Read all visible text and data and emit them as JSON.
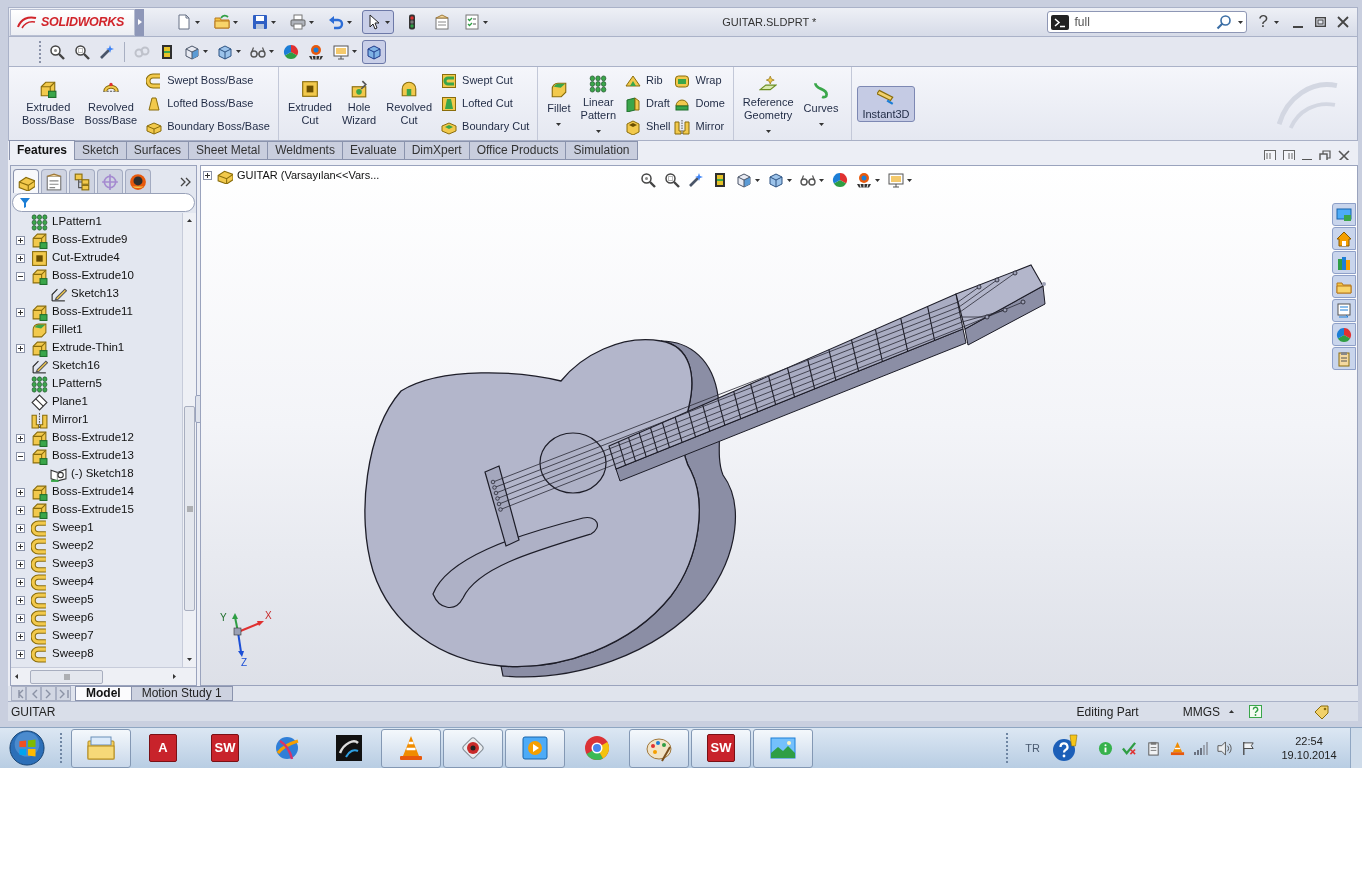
{
  "app": {
    "logo": "SOLIDWORKS",
    "title": "GUITAR.SLDPRT *"
  },
  "quick_access": [
    {
      "kind": "new",
      "dropdown": true,
      "pressed": false
    },
    {
      "kind": "open",
      "dropdown": true,
      "pressed": false
    },
    {
      "kind": "save",
      "dropdown": true,
      "pressed": false
    },
    {
      "kind": "print",
      "dropdown": true,
      "pressed": false
    },
    {
      "kind": "undo",
      "dropdown": true,
      "pressed": false
    },
    {
      "kind": "select",
      "dropdown": true,
      "pressed": true
    },
    {
      "kind": "rebuild",
      "dropdown": false,
      "pressed": false
    },
    {
      "kind": "properties",
      "dropdown": false,
      "pressed": false
    },
    {
      "kind": "options",
      "dropdown": true,
      "pressed": false
    }
  ],
  "search": {
    "value": "full"
  },
  "help": "?",
  "view_toolbar": [
    {
      "kind": "zoom-fit",
      "dropdown": false,
      "pressed": false,
      "disabled": false
    },
    {
      "kind": "zoom-area",
      "dropdown": false,
      "pressed": false,
      "disabled": false
    },
    {
      "kind": "previous",
      "dropdown": false,
      "pressed": false,
      "disabled": false
    },
    {
      "kind": "rings",
      "dropdown": false,
      "pressed": false,
      "disabled": true
    },
    {
      "kind": "section",
      "dropdown": false,
      "pressed": false,
      "disabled": false
    },
    {
      "kind": "orient",
      "dropdown": true,
      "pressed": false,
      "disabled": false
    },
    {
      "kind": "display",
      "dropdown": true,
      "pressed": false,
      "disabled": false
    },
    {
      "kind": "hide",
      "dropdown": true,
      "pressed": false,
      "disabled": false
    },
    {
      "kind": "appearance",
      "dropdown": false,
      "pressed": false,
      "disabled": false
    },
    {
      "kind": "scene",
      "dropdown": false,
      "pressed": false,
      "disabled": false
    },
    {
      "kind": "settings",
      "dropdown": true,
      "pressed": false,
      "disabled": false
    },
    {
      "kind": "shaded",
      "dropdown": false,
      "pressed": true,
      "disabled": false
    }
  ],
  "ribbon": {
    "groups": [
      {
        "large": [
          {
            "kind": "extrude",
            "label": "Extruded\nBoss/Base",
            "dropdown": false
          },
          {
            "kind": "revolve",
            "label": "Revolved\nBoss/Base",
            "dropdown": false
          }
        ],
        "stacks": [
          [
            {
              "kind": "sweep",
              "label": "Swept Boss/Base"
            },
            {
              "kind": "loft",
              "label": "Lofted Boss/Base"
            },
            {
              "kind": "boundary",
              "label": "Boundary Boss/Base"
            }
          ]
        ]
      },
      {
        "large": [
          {
            "kind": "cut-extrude",
            "label": "Extruded\nCut",
            "dropdown": false
          },
          {
            "kind": "hole",
            "label": "Hole\nWizard",
            "dropdown": false
          },
          {
            "kind": "cut-revolve",
            "label": "Revolved\nCut",
            "dropdown": false
          }
        ],
        "stacks": [
          [
            {
              "kind": "cut-sweep",
              "label": "Swept Cut"
            },
            {
              "kind": "cut-loft",
              "label": "Lofted Cut"
            },
            {
              "kind": "cut-boundary",
              "label": "Boundary Cut"
            }
          ]
        ]
      },
      {
        "large": [
          {
            "kind": "fillet",
            "label": "Fillet",
            "dropdown": true
          },
          {
            "kind": "pattern",
            "label": "Linear\nPattern",
            "dropdown": true
          }
        ],
        "stacks": [
          [
            {
              "kind": "rib",
              "label": "Rib"
            },
            {
              "kind": "draft",
              "label": "Draft"
            },
            {
              "kind": "shell",
              "label": "Shell"
            }
          ],
          [
            {
              "kind": "wrap",
              "label": "Wrap"
            },
            {
              "kind": "dome",
              "label": "Dome"
            },
            {
              "kind": "mirror",
              "label": "Mirror"
            }
          ]
        ]
      },
      {
        "large": [
          {
            "kind": "refgeom",
            "label": "Reference\nGeometry",
            "dropdown": true
          },
          {
            "kind": "curves",
            "label": "Curves",
            "dropdown": true
          }
        ]
      }
    ],
    "toggle": {
      "kind": "instant3d",
      "label": "Instant3D",
      "on": true
    }
  },
  "tabs": [
    {
      "label": "Features",
      "selected": true
    },
    {
      "label": "Sketch",
      "selected": false
    },
    {
      "label": "Surfaces",
      "selected": false
    },
    {
      "label": "Sheet Metal",
      "selected": false
    },
    {
      "label": "Weldments",
      "selected": false
    },
    {
      "label": "Evaluate",
      "selected": false
    },
    {
      "label": "DimXpert",
      "selected": false
    },
    {
      "label": "Office Products",
      "selected": false
    },
    {
      "label": "Simulation",
      "selected": false
    }
  ],
  "panel_tabs": [
    {
      "kind": "features",
      "selected": true
    },
    {
      "kind": "properties",
      "selected": false
    },
    {
      "kind": "configurations",
      "selected": false
    },
    {
      "kind": "dimxpert",
      "selected": false
    },
    {
      "kind": "display",
      "selected": false
    }
  ],
  "feature_tree": [
    {
      "kind": "pattern",
      "label": "LPattern1"
    },
    {
      "kind": "extrude",
      "label": "Boss-Extrude9",
      "expanded": false
    },
    {
      "kind": "cut-extrude",
      "label": "Cut-Extrude4",
      "expanded": false
    },
    {
      "kind": "extrude",
      "label": "Boss-Extrude10",
      "expanded": true,
      "children": [
        {
          "kind": "sketch",
          "label": "Sketch13"
        }
      ]
    },
    {
      "kind": "extrude",
      "label": "Boss-Extrude11",
      "expanded": false
    },
    {
      "kind": "fillet",
      "label": "Fillet1"
    },
    {
      "kind": "extrude",
      "label": "Extrude-Thin1",
      "expanded": false
    },
    {
      "kind": "sketch",
      "label": "Sketch16"
    },
    {
      "kind": "pattern",
      "label": "LPattern5"
    },
    {
      "kind": "plane",
      "label": "Plane1"
    },
    {
      "kind": "mirror",
      "label": "Mirror1"
    },
    {
      "kind": "extrude",
      "label": "Boss-Extrude12",
      "expanded": false
    },
    {
      "kind": "extrude",
      "label": "Boss-Extrude13",
      "expanded": true,
      "children": [
        {
          "kind": "sketch-plane",
          "label": "(-) Sketch18"
        }
      ]
    },
    {
      "kind": "extrude",
      "label": "Boss-Extrude14",
      "expanded": false
    },
    {
      "kind": "extrude",
      "label": "Boss-Extrude15",
      "expanded": false
    },
    {
      "kind": "sweep",
      "label": "Sweep1",
      "expanded": false
    },
    {
      "kind": "sweep",
      "label": "Sweep2",
      "expanded": false
    },
    {
      "kind": "sweep",
      "label": "Sweep3",
      "expanded": false
    },
    {
      "kind": "sweep",
      "label": "Sweep4",
      "expanded": false
    },
    {
      "kind": "sweep",
      "label": "Sweep5",
      "expanded": false
    },
    {
      "kind": "sweep",
      "label": "Sweep6",
      "expanded": false
    },
    {
      "kind": "sweep",
      "label": "Sweep7",
      "expanded": false
    },
    {
      "kind": "sweep",
      "label": "Sweep8",
      "expanded": false
    }
  ],
  "viewport": {
    "flyout": {
      "label": "GUITAR (Varsayılan<<Vars...",
      "expanded": false
    },
    "heads_up": [
      {
        "kind": "zoom-fit",
        "dropdown": false
      },
      {
        "kind": "zoom-area",
        "dropdown": false
      },
      {
        "kind": "previous",
        "dropdown": false
      },
      {
        "kind": "section",
        "dropdown": false
      },
      {
        "kind": "orient",
        "dropdown": true
      },
      {
        "kind": "display",
        "dropdown": true
      },
      {
        "kind": "hide",
        "dropdown": true
      },
      {
        "kind": "appearance",
        "dropdown": false
      },
      {
        "kind": "scene",
        "dropdown": true
      },
      {
        "kind": "settings",
        "dropdown": true
      }
    ],
    "triad": [
      "Y",
      "X",
      "Z"
    ]
  },
  "bottom_tabs": [
    {
      "label": "Model",
      "selected": true
    },
    {
      "label": "Motion Study 1",
      "selected": false
    }
  ],
  "status_bar": {
    "document": "GUITAR",
    "mode": "Editing Part",
    "units": "MMGS"
  },
  "taskbar": {
    "apps": [
      {
        "kind": "explorer",
        "running": true
      },
      {
        "kind": "tile",
        "glyph": "A",
        "running": false
      },
      {
        "kind": "tile",
        "glyph": "SW",
        "running": false
      },
      {
        "kind": "globe",
        "running": false
      },
      {
        "kind": "swoosh",
        "running": false
      },
      {
        "kind": "cone",
        "running": true
      },
      {
        "kind": "webcam",
        "running": true
      },
      {
        "kind": "player",
        "running": true
      },
      {
        "kind": "browser",
        "running": false
      },
      {
        "kind": "paint",
        "running": true
      },
      {
        "kind": "tile",
        "glyph": "SW",
        "running": true
      },
      {
        "kind": "photos",
        "running": true
      }
    ],
    "language": "TR",
    "time": "22:54",
    "date": "19.10.2014"
  }
}
